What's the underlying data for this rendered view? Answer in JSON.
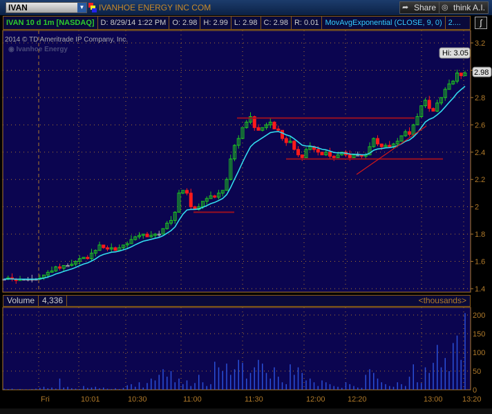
{
  "toolbar": {
    "symbol": "IVAN",
    "company": "IVANHOE ENERGY INC COM",
    "share": "Share",
    "think": "think A.I."
  },
  "info": {
    "title": "IVAN 10 d 1m [NASDAQ]",
    "date": "D: 8/29/14 1:22 PM",
    "open": "O: 2.98",
    "high": "H: 2.99",
    "low": "L: 2.98",
    "close": "C: 2.98",
    "range": "R: 0.01",
    "study": "MovAvgExponential (CLOSE, 9, 0)",
    "more": "2...."
  },
  "copyright": "2014 © TD Ameritrade IP Company, Inc.",
  "watermark": "Ivanhoe Energy",
  "volume": {
    "label": "Volume",
    "value": "4,336",
    "units": "<thousands>"
  },
  "colors": {
    "up": "#1ecb1e",
    "down": "#ff1a1a",
    "flat": "#b0b0b0",
    "ema": "#33ddee",
    "drawing": "#9a1020",
    "volume": "#2a4fd8",
    "axis": "#b07a2a"
  },
  "chart_data": {
    "type": "candlestick",
    "title": "IVAN 10 d 1m [NASDAQ]",
    "ylim": [
      1.4,
      3.2
    ],
    "yticks": [
      "3.2",
      "3",
      "2.8",
      "2.6",
      "2.4",
      "2.2",
      "2",
      "1.8",
      "1.6",
      "1.4"
    ],
    "xticks": [
      "Fri",
      "10:01",
      "10:30",
      "11:00",
      "11:30",
      "12:00",
      "12:20",
      "13:00",
      "13:20"
    ],
    "hi_label": "Hi: 3.05",
    "last_label": "2.98",
    "ema_period": 9,
    "closes": [
      1.47,
      1.48,
      1.47,
      1.46,
      1.47,
      1.47,
      1.47,
      1.47,
      1.47,
      1.48,
      1.5,
      1.52,
      1.53,
      1.56,
      1.55,
      1.57,
      1.57,
      1.58,
      1.6,
      1.62,
      1.63,
      1.62,
      1.66,
      1.68,
      1.72,
      1.7,
      1.69,
      1.7,
      1.68,
      1.7,
      1.72,
      1.73,
      1.76,
      1.78,
      1.79,
      1.8,
      1.78,
      1.79,
      1.8,
      1.8,
      1.84,
      1.88,
      1.9,
      1.96,
      2.1,
      2.12,
      2.1,
      2.0,
      1.98,
      2.0,
      2.04,
      2.06,
      2.08,
      2.07,
      2.1,
      2.12,
      2.2,
      2.35,
      2.45,
      2.5,
      2.58,
      2.62,
      2.66,
      2.58,
      2.56,
      2.58,
      2.6,
      2.62,
      2.57,
      2.56,
      2.5,
      2.47,
      2.48,
      2.42,
      2.38,
      2.36,
      2.42,
      2.44,
      2.42,
      2.4,
      2.38,
      2.4,
      2.37,
      2.36,
      2.38,
      2.4,
      2.38,
      2.36,
      2.38,
      2.38,
      2.37,
      2.38,
      2.44,
      2.5,
      2.46,
      2.44,
      2.45,
      2.44,
      2.46,
      2.48,
      2.52,
      2.55,
      2.53,
      2.6,
      2.66,
      2.74,
      2.78,
      2.72,
      2.7,
      2.76,
      2.8,
      2.86,
      2.9,
      2.92,
      2.98,
      2.96,
      2.98
    ],
    "drawings": {
      "resistance": 2.65,
      "support": 2.35,
      "support_low": 1.96
    },
    "volume_ylim": [
      0,
      200
    ],
    "volume_yticks": [
      "200",
      "150",
      "100",
      "50",
      "0"
    ],
    "volumes": [
      3,
      2,
      3,
      1,
      2,
      1,
      1,
      2,
      3,
      5,
      8,
      4,
      6,
      3,
      30,
      6,
      8,
      4,
      3,
      2,
      10,
      5,
      6,
      8,
      4,
      6,
      3,
      2,
      4,
      2,
      5,
      12,
      15,
      8,
      20,
      6,
      18,
      30,
      25,
      40,
      55,
      35,
      50,
      20,
      30,
      15,
      25,
      10,
      18,
      40,
      20,
      10,
      15,
      75,
      60,
      50,
      70,
      40,
      55,
      80,
      72,
      30,
      45,
      60,
      80,
      70,
      45,
      30,
      60,
      35,
      20,
      15,
      68,
      40,
      60,
      45,
      25,
      30,
      20,
      10,
      25,
      20,
      15,
      10,
      8,
      5,
      20,
      15,
      10,
      6,
      5,
      40,
      55,
      45,
      30,
      20,
      15,
      10,
      8,
      20,
      15,
      10,
      35,
      68,
      20,
      18,
      60,
      45,
      72,
      120,
      60,
      85,
      50,
      125,
      145,
      80,
      205
    ]
  }
}
